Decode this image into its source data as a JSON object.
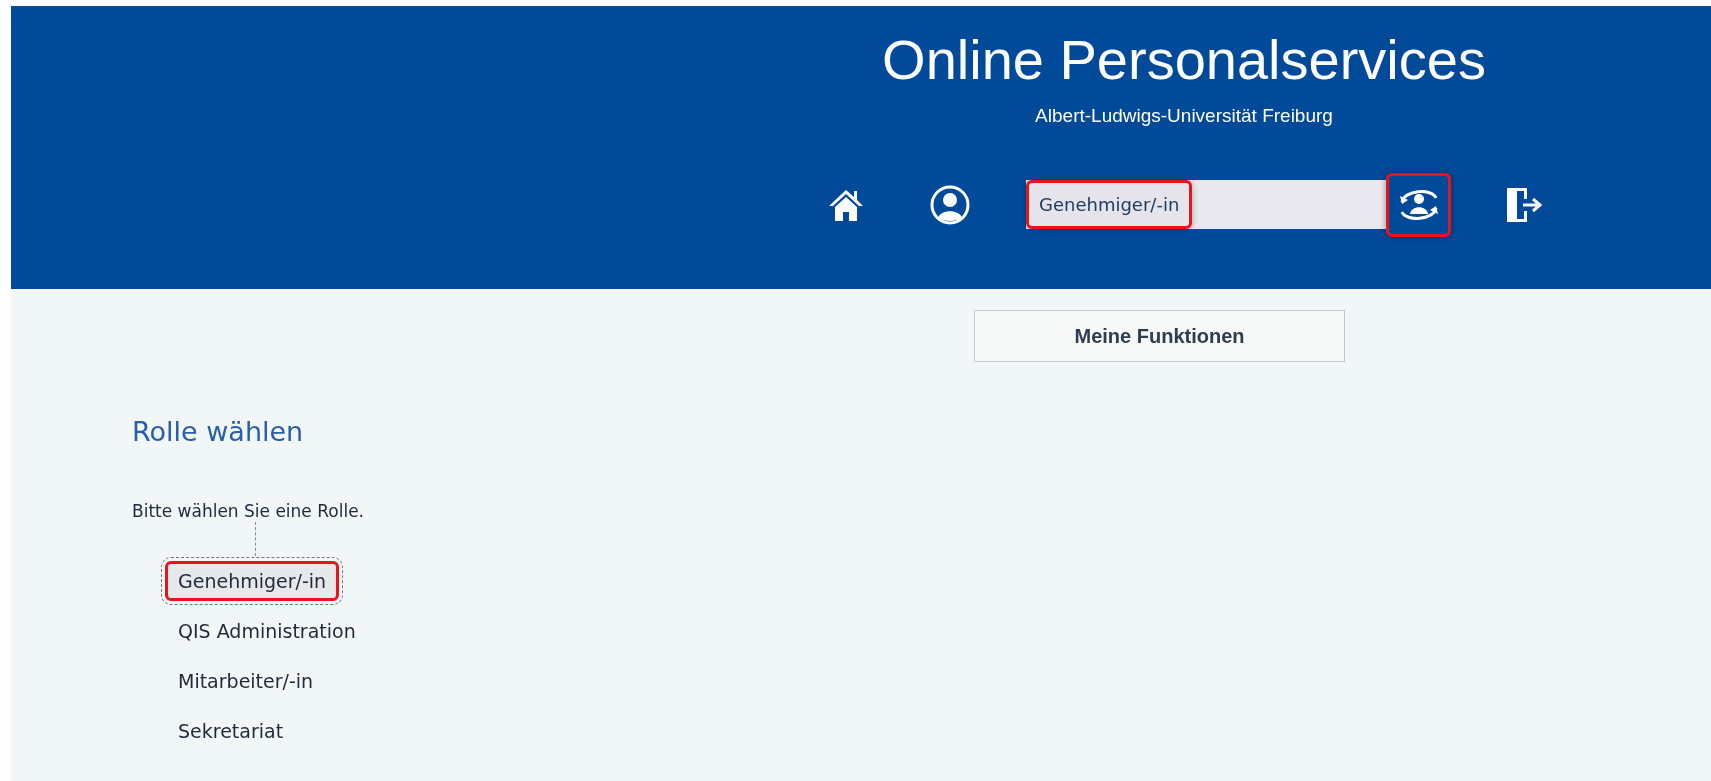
{
  "header": {
    "title": "Online Personalservices",
    "subtitle": "Albert-Ludwigs-Universität Freiburg",
    "role_field": {
      "value": "Genehmiger/-in",
      "highlighted": true
    },
    "switch_role_button": {
      "highlighted": true
    }
  },
  "functions_button": "Meine Funktionen",
  "section": {
    "heading": "Rolle wählen",
    "instruction": "Bitte wählen Sie eine Rolle.",
    "roles": [
      {
        "label": "Genehmiger/-in",
        "selected": true,
        "highlighted": true
      },
      {
        "label": "QIS Administration",
        "selected": false,
        "highlighted": false
      },
      {
        "label": "Mitarbeiter/-in",
        "selected": false,
        "highlighted": false
      },
      {
        "label": "Sekretariat",
        "selected": false,
        "highlighted": false
      }
    ]
  }
}
